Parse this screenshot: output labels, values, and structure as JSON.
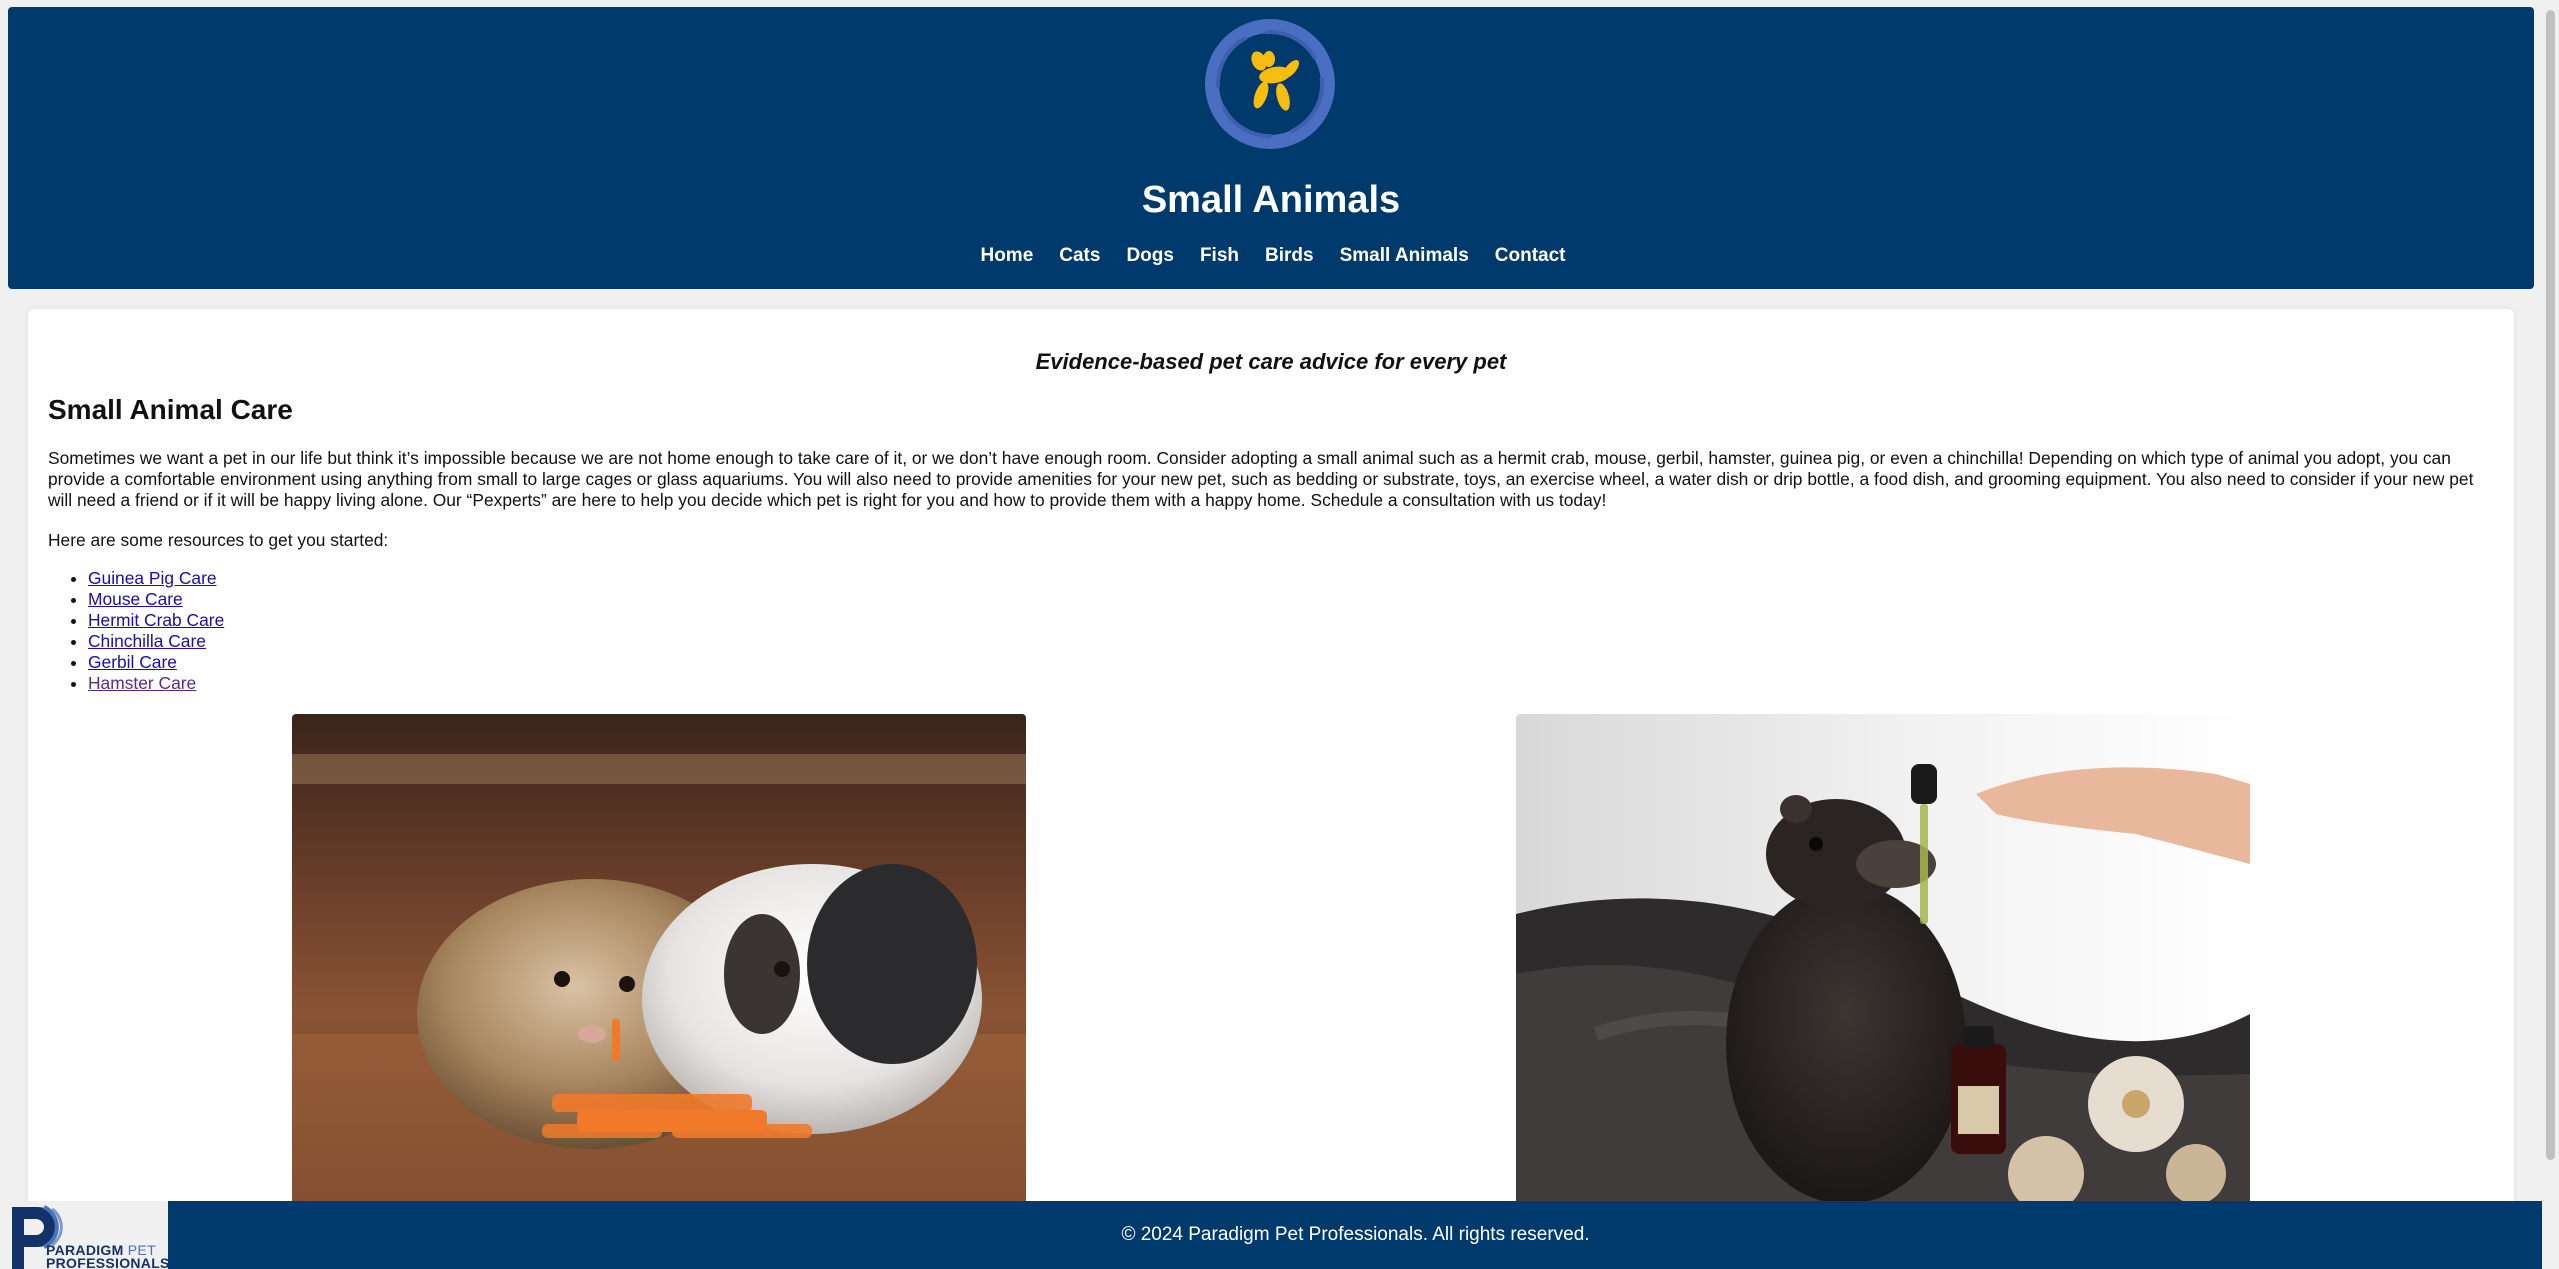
{
  "header": {
    "title": "Small Animals",
    "logo_icon": "balloon-dog-icon",
    "nav": [
      "Home",
      "Cats",
      "Dogs",
      "Fish",
      "Birds",
      "Small Animals",
      "Contact"
    ]
  },
  "main": {
    "tagline": "Evidence-based pet care advice for every pet",
    "heading": "Small Animal Care",
    "intro": "Sometimes we want a pet in our life but think it’s impossible because we are not home enough to take care of it, or we don’t have enough room. Consider adopting a small animal such as a hermit crab, mouse, gerbil, hamster, guinea pig, or even a chinchilla! Depending on which type of animal you adopt, you can provide a comfortable environment using anything from small to large cages or glass aquariums. You will also need to provide amenities for your new pet, such as bedding or substrate, toys, an exercise wheel, a water dish or drip bottle, a food dish, and grooming equipment. You also need to consider if your new pet will need a friend or if it will be happy living alone. Our “Pexperts” are here to help you decide which pet is right for you and how to provide them with a happy home. Schedule a consultation with us today!",
    "resources_label": "Here are some resources to get you started:",
    "resources": [
      "Guinea Pig Care",
      "Mouse Care",
      "Hermit Crab Care",
      "Chinchilla Care",
      "Gerbil Care",
      "Hamster Care"
    ]
  },
  "footer": {
    "copyright": "© 2024 Paradigm Pet Professionals. All rights reserved.",
    "brand_line1": "PARADIGM",
    "brand_pet": "PET",
    "brand_line2": "PROFESSIONALS"
  },
  "colors": {
    "header_bg": "#003a6c",
    "link": "#1a0dab",
    "visited_link": "#5a2a86",
    "logo_ring": "#4a6fc0",
    "logo_dog": "#f6bd0f"
  }
}
